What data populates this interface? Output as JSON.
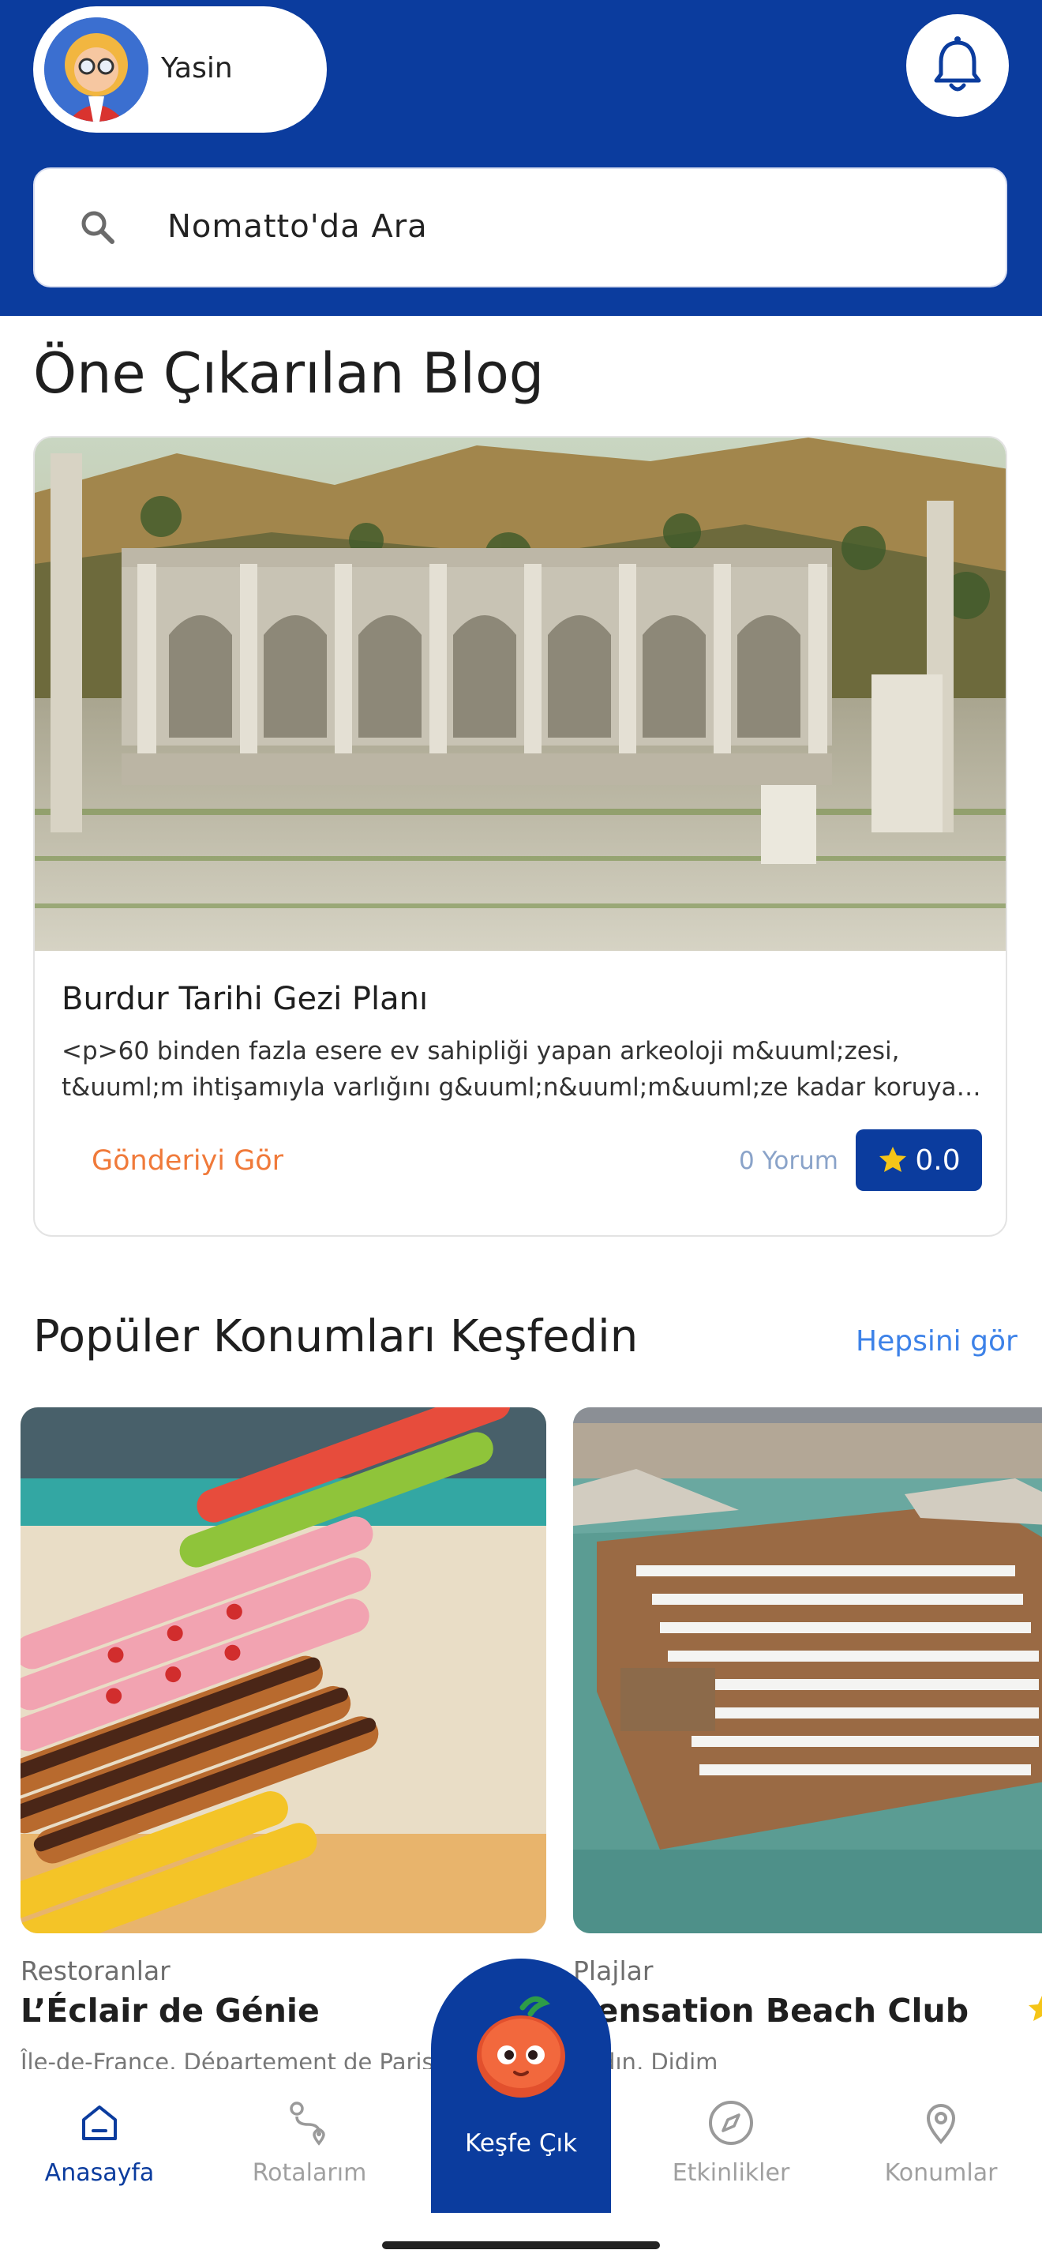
{
  "header": {
    "user_name": "Yasin",
    "search_placeholder": "Nomatto'da Ara"
  },
  "featured": {
    "section_title": "Öne Çıkarılan Blog",
    "post": {
      "title": "Burdur Tarihi Gezi Planı",
      "excerpt_line1": "<p>60 binden fazla esere ev sahipliği yapan arkeoloji m&uuml;zesi,",
      "excerpt_line2": "t&uuml;m ihtişamıyla varlığını g&uuml;n&uuml;m&uuml;ze kadar koruyan...",
      "see_post_label": "Gönderiyi Gör",
      "comments_label": "0 Yorum",
      "rating": "0.0"
    }
  },
  "popular": {
    "section_title": "Popüler Konumları Keşfedin",
    "see_all_label": "Hepsini gör",
    "locations": [
      {
        "category": "Restoranlar",
        "name": "L’Éclair de Génie",
        "address": "Île-de-France, Département de Paris"
      },
      {
        "category": "Plajlar",
        "name": "Sensation Beach Club",
        "address": "Aydın, Didim"
      }
    ]
  },
  "nav": {
    "items": [
      {
        "label": "Anasayfa",
        "icon": "home-icon",
        "active": true
      },
      {
        "label": "Rotalarım",
        "icon": "route-icon",
        "active": false
      },
      {
        "label": "Keşfe Çık",
        "icon": "mascot-icon",
        "active": false
      },
      {
        "label": "Etkinlikler",
        "icon": "compass-icon",
        "active": false
      },
      {
        "label": "Konumlar",
        "icon": "location-pin-icon",
        "active": false
      }
    ]
  },
  "colors": {
    "brand_blue": "#0b3c9e",
    "accent_orange": "#f07a3a",
    "link_blue": "#3d82e8",
    "star_yellow": "#f5c518"
  }
}
